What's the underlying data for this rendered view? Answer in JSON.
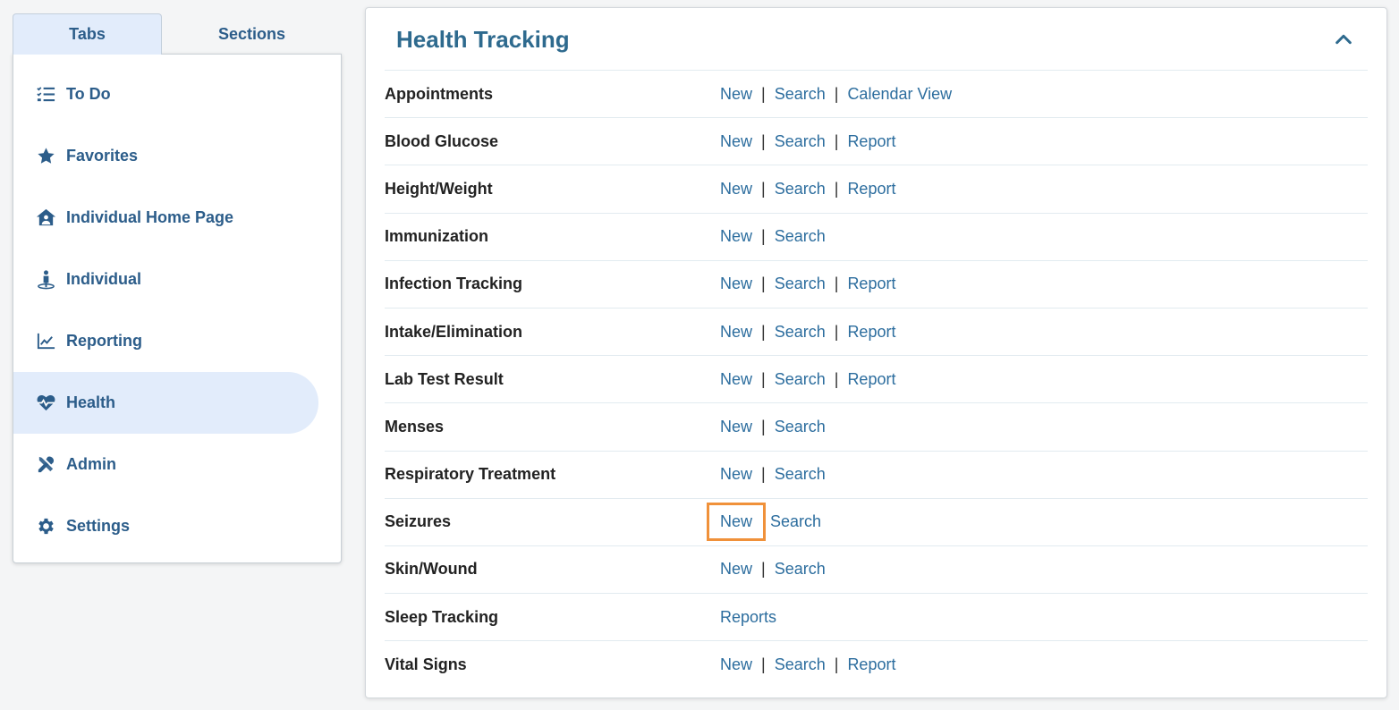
{
  "nav": {
    "tabs": [
      {
        "label": "Tabs",
        "active": true
      },
      {
        "label": "Sections",
        "active": false
      }
    ],
    "items": [
      {
        "label": "To Do",
        "icon": "todo-list-icon"
      },
      {
        "label": "Favorites",
        "icon": "star-icon"
      },
      {
        "label": "Individual Home Page",
        "icon": "home-user-icon"
      },
      {
        "label": "Individual",
        "icon": "person-icon"
      },
      {
        "label": "Reporting",
        "icon": "chart-line-icon"
      },
      {
        "label": "Health",
        "icon": "heartbeat-icon",
        "active": true
      },
      {
        "label": "Admin",
        "icon": "tools-icon"
      },
      {
        "label": "Settings",
        "icon": "gear-icon"
      }
    ]
  },
  "main": {
    "title": "Health Tracking",
    "rows": [
      {
        "label": "Appointments",
        "links": [
          "New",
          "Search",
          "Calendar View"
        ]
      },
      {
        "label": "Blood Glucose",
        "links": [
          "New",
          "Search",
          "Report"
        ]
      },
      {
        "label": "Height/Weight",
        "links": [
          "New",
          "Search",
          "Report"
        ]
      },
      {
        "label": "Immunization",
        "links": [
          "New",
          "Search"
        ]
      },
      {
        "label": "Infection Tracking",
        "links": [
          "New",
          "Search",
          "Report"
        ]
      },
      {
        "label": "Intake/Elimination",
        "links": [
          "New",
          "Search",
          "Report"
        ]
      },
      {
        "label": "Lab Test Result",
        "links": [
          "New",
          "Search",
          "Report"
        ]
      },
      {
        "label": "Menses",
        "links": [
          "New",
          "Search"
        ]
      },
      {
        "label": "Respiratory Treatment",
        "links": [
          "New",
          "Search"
        ]
      },
      {
        "label": "Seizures",
        "links": [
          "New",
          "Search"
        ],
        "highlight": 0
      },
      {
        "label": "Skin/Wound",
        "links": [
          "New",
          "Search"
        ]
      },
      {
        "label": "Sleep Tracking",
        "links": [
          "Reports"
        ]
      },
      {
        "label": "Vital Signs",
        "links": [
          "New",
          "Search",
          "Report"
        ]
      }
    ]
  },
  "colors": {
    "accent": "#2c5d8a",
    "link": "#2c6d9e",
    "active_bg": "#e2ecfb",
    "highlight": "#f0913a"
  }
}
